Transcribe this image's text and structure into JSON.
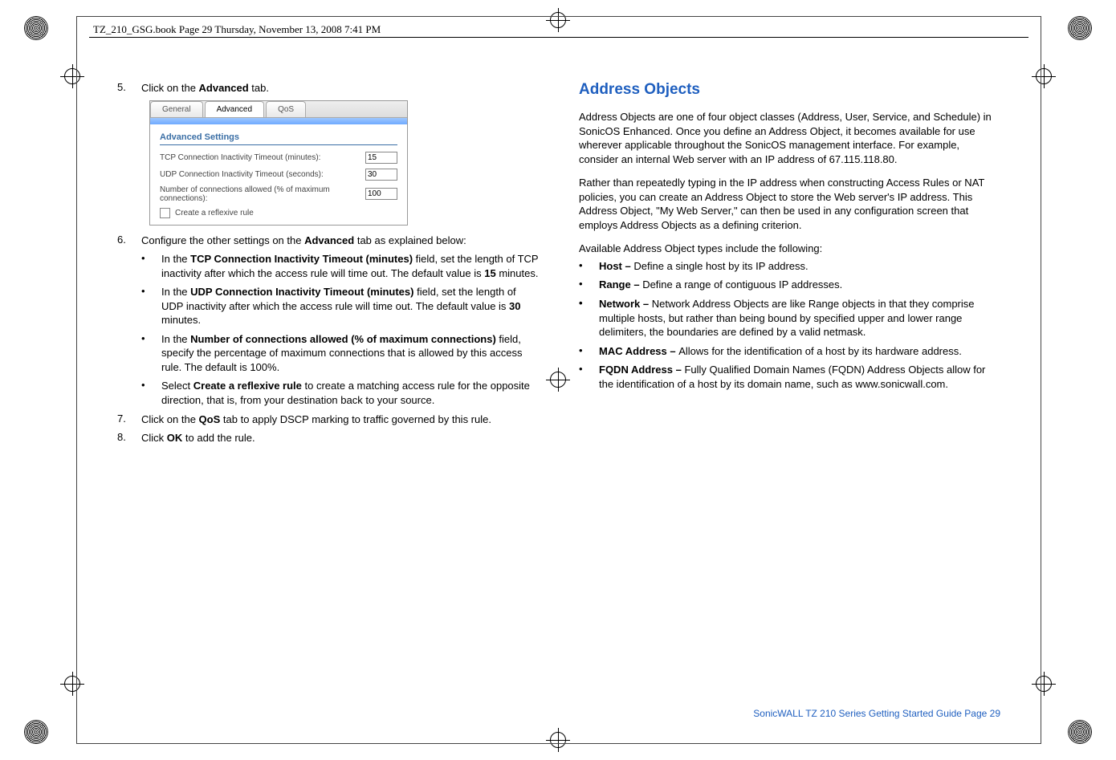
{
  "header": {
    "running": "TZ_210_GSG.book  Page 29  Thursday, November 13, 2008  7:41 PM"
  },
  "left": {
    "step5_num": "5.",
    "step5_text_a": "Click on the ",
    "step5_bold": "Advanced",
    "step5_text_b": " tab.",
    "screenshot": {
      "tab1": "General",
      "tab2": "Advanced",
      "tab3": "QoS",
      "heading": "Advanced Settings",
      "row1_label": "TCP Connection Inactivity Timeout (minutes):",
      "row1_val": "15",
      "row2_label": "UDP Connection Inactivity Timeout (seconds):",
      "row2_val": "30",
      "row3_label": "Number of connections allowed (% of maximum connections):",
      "row3_val": "100",
      "check_label": "Create a reflexive rule"
    },
    "step6_num": "6.",
    "step6_a": "Configure the other settings on the ",
    "step6_bold": "Advanced",
    "step6_b": " tab as explained below:",
    "b1_a": "In the ",
    "b1_bold": "TCP Connection Inactivity Timeout (minutes)",
    "b1_b": " field, set the length of TCP inactivity after which the access rule will time out. The default value is ",
    "b1_bold2": "15",
    "b1_c": " minutes.",
    "b2_a": "In the ",
    "b2_bold": "UDP Connection Inactivity Timeout (minutes)",
    "b2_b": " field, set the length of UDP inactivity after which the access rule will time out. The default value is ",
    "b2_bold2": "30",
    "b2_c": " minutes.",
    "b3_a": "In the ",
    "b3_bold": "Number of connections allowed (% of maximum connections)",
    "b3_b": " field, specify the percentage of maximum connections that is allowed by this access rule. The default is 100%.",
    "b4_a": "Select ",
    "b4_bold": "Create a reflexive rule",
    "b4_b": " to create a matching access rule for the opposite direction, that is, from your destination back to your source.",
    "step7_num": "7.",
    "step7_a": "Click on the ",
    "step7_bold": "QoS",
    "step7_b": " tab to apply DSCP marking to traffic governed by this rule.",
    "step8_num": "8.",
    "step8_a": "Click ",
    "step8_bold": "OK",
    "step8_b": " to add the rule."
  },
  "right": {
    "title": "Address Objects",
    "p1": "Address Objects are one of four object classes (Address, User, Service, and Schedule) in SonicOS Enhanced. Once you define an Address Object, it becomes available for use wherever applicable throughout the SonicOS management interface. For example, consider an internal Web server with an IP address of 67.115.118.80.",
    "p2": "Rather than repeatedly typing in the IP address when constructing Access Rules or NAT policies, you can create an Address Object to store the Web server's IP address. This Address Object, \"My Web Server,\" can then be used in any configuration screen that employs Address Objects as a defining criterion.",
    "p3": "Available Address Object types include the following:",
    "li1_bold": "Host – ",
    "li1": "Define a single host by its IP address.",
    "li2_bold": "Range – ",
    "li2": "Define a range of contiguous IP addresses.",
    "li3_bold": "Network – ",
    "li3": "Network Address Objects are like Range objects in that they comprise multiple hosts, but rather than being bound by specified upper and lower range delimiters, the boundaries are defined by a valid netmask.",
    "li4_bold": "MAC Address – ",
    "li4": "Allows for the identification of a host by its hardware address.",
    "li5_bold": "FQDN Address – ",
    "li5": "Fully Qualified Domain Names (FQDN) Address Objects allow for the identification of a host by its domain name, such as www.sonicwall.com."
  },
  "footer": {
    "text": "SonicWALL TZ 210 Series Getting Started Guide  Page 29"
  }
}
